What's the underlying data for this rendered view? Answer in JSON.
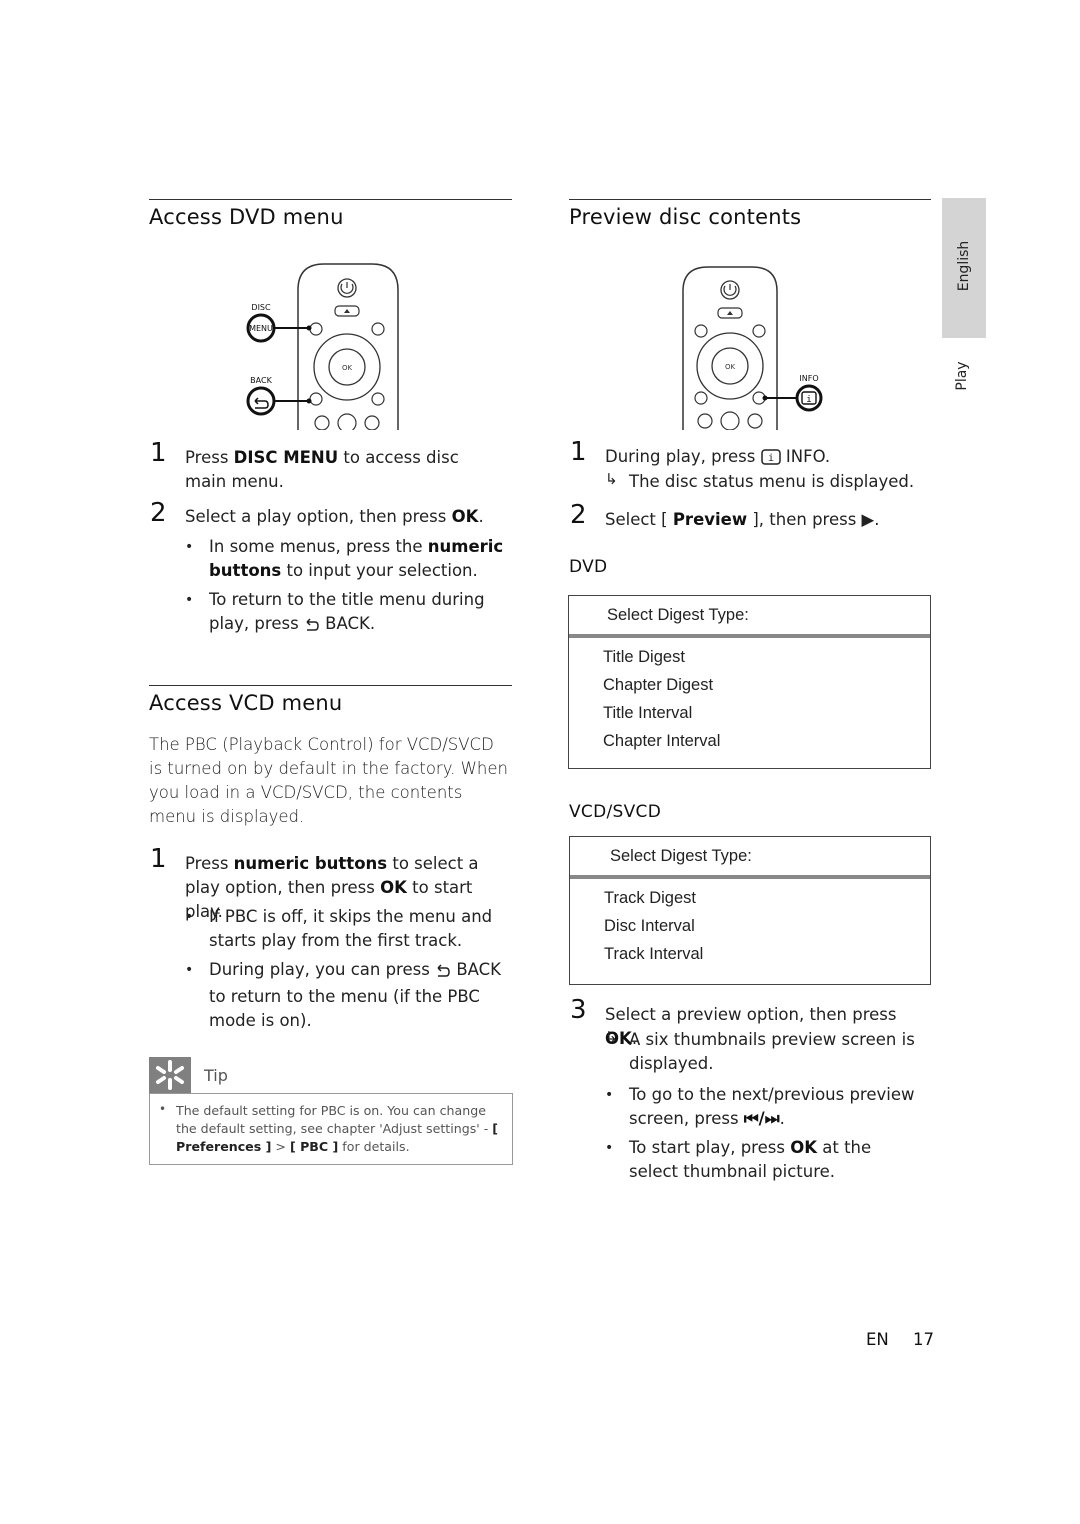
{
  "side_tab": {
    "language": "English",
    "section": "Play"
  },
  "left": {
    "dvd_section": {
      "title": "Access DVD menu",
      "remote_labels": {
        "disc": "DISC",
        "menu": "MENU",
        "back": "BACK",
        "ok": "OK"
      },
      "steps": [
        {
          "num": "1",
          "pre": "Press ",
          "bold": "DISC MENU",
          "post": " to access disc main menu."
        },
        {
          "num": "2",
          "pre": "Select a play option, then press ",
          "bold": "OK",
          "post": "."
        }
      ],
      "bullets": [
        {
          "pre": "In some menus, press the ",
          "bold": "numeric buttons",
          "post": " to input your selection."
        },
        {
          "pre": "To return to the title menu during play, press ",
          "icon": "back-arrow-icon",
          "bold": "BACK",
          "post": "."
        }
      ]
    },
    "vcd_section": {
      "title": "Access VCD menu",
      "intro": "The PBC (Playback Control) for VCD/SVCD is turned on by default in the factory. When you load in a VCD/SVCD, the contents menu is displayed.",
      "steps": [
        {
          "num": "1",
          "pre": "Press ",
          "bold": "numeric buttons",
          "mid": " to select a play option, then press ",
          "bold2": "OK",
          "post": " to start play."
        }
      ],
      "bullets": [
        {
          "text": "If PBC is off, it skips the menu and starts play from the first track."
        },
        {
          "pre": "During play, you can press ",
          "icon": "back-arrow-icon",
          "bold": "BACK",
          "post": " to return to the menu (if the PBC mode is on)."
        }
      ]
    },
    "tip": {
      "label": "Tip",
      "text_pre": "The default setting for PBC is on. You can change the default setting, see chapter 'Adjust settings' - ",
      "bold1": "[ Preferences ]",
      "sep": " > ",
      "bold2": "[ PBC ]",
      "text_post": " for details."
    }
  },
  "right": {
    "preview_section": {
      "title": "Preview disc contents",
      "remote_labels": {
        "info": "INFO",
        "ok": "OK"
      },
      "steps": [
        {
          "num": "1",
          "pre": "During play, press ",
          "icon": "info-icon",
          "bold": "INFO",
          "post": ".",
          "result": "The disc status menu is displayed."
        },
        {
          "num": "2",
          "pre": "Select [ ",
          "bold": "Preview",
          "post": " ], then press ▶."
        },
        {
          "num": "3",
          "pre": "Select a preview option, then press ",
          "bold": "OK",
          "post": ".",
          "result": "A six thumbnails preview screen is displayed."
        }
      ],
      "dvd_label": "DVD",
      "dvd_menu": {
        "header": "Select Digest Type:",
        "items": [
          "Title Digest",
          "Chapter Digest",
          "Title Interval",
          "Chapter Interval"
        ]
      },
      "vcd_label": "VCD/SVCD",
      "vcd_menu": {
        "header": "Select Digest Type:",
        "items": [
          "Track Digest",
          "Disc Interval",
          "Track Interval"
        ]
      },
      "bullets": [
        {
          "pre": "To go to the next/previous preview screen, press ",
          "glyph": "⏮/⏭",
          "post": "."
        },
        {
          "pre": "To start play, press ",
          "bold": "OK",
          "post": " at the select thumbnail picture."
        }
      ]
    }
  },
  "footer": {
    "lang": "EN",
    "page": "17"
  }
}
